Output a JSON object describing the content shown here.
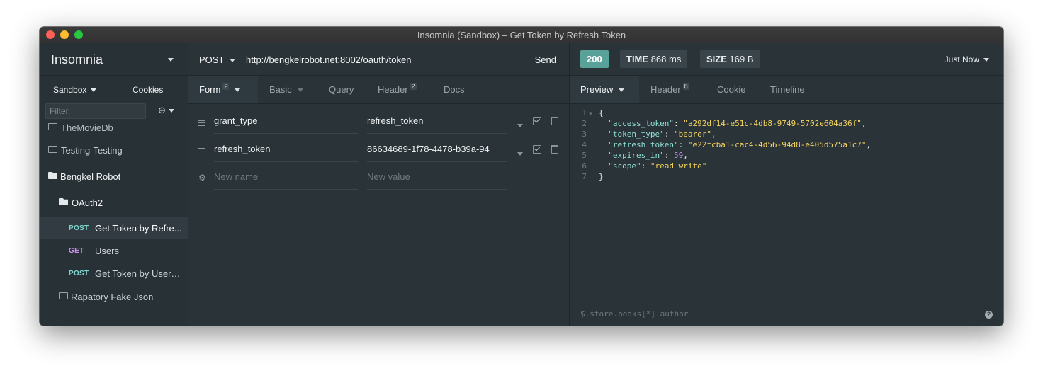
{
  "window": {
    "title": "Insomnia (Sandbox) – Get Token by Refresh Token"
  },
  "sidebar": {
    "app_name": "Insomnia",
    "environment": "Sandbox",
    "cookies_label": "Cookies",
    "filter_placeholder": "Filter",
    "add_icon": "plus-circle-icon",
    "items": [
      {
        "type": "folder",
        "label": "TheMovieDb"
      },
      {
        "type": "folder",
        "label": "Testing-Testing"
      },
      {
        "type": "folder-open",
        "label": "Bengkel Robot"
      },
      {
        "type": "folder-open",
        "label": "OAuth2"
      },
      {
        "type": "request",
        "method": "POST",
        "label": "Get Token by Refre...",
        "method_color": "#7ed6cf",
        "active": true
      },
      {
        "type": "request",
        "method": "GET",
        "label": "Users",
        "method_color": "#c792ea"
      },
      {
        "type": "request",
        "method": "POST",
        "label": "Get Token by Usern...",
        "method_color": "#7ed6cf"
      },
      {
        "type": "folder",
        "label": "Rapatory Fake Json"
      }
    ]
  },
  "request": {
    "method": "POST",
    "url": "http://bengkelrobot.net:8002/oauth/token",
    "send_label": "Send",
    "tabs": [
      {
        "label": "Form",
        "count": "2"
      },
      {
        "label": "Basic"
      },
      {
        "label": "Query"
      },
      {
        "label": "Header",
        "count": "2"
      },
      {
        "label": "Docs"
      }
    ],
    "params": [
      {
        "name": "grant_type",
        "value": "refresh_token"
      },
      {
        "name": "refresh_token",
        "value": "86634689-1f78-4478-b39a-94"
      }
    ],
    "new_name_placeholder": "New name",
    "new_value_placeholder": "New value"
  },
  "response": {
    "status": "200",
    "time_label": "TIME",
    "time_value": "868 ms",
    "size_label": "SIZE",
    "size_value": "169 B",
    "when": "Just Now",
    "tabs": [
      {
        "label": "Preview"
      },
      {
        "label": "Header",
        "count": "8"
      },
      {
        "label": "Cookie"
      },
      {
        "label": "Timeline"
      }
    ],
    "line_numbers": [
      "1",
      "2",
      "3",
      "4",
      "5",
      "6",
      "7"
    ],
    "body": {
      "access_token": "\"a292df14-e51c-4db8-9749-5702e604a36f\"",
      "token_type": "\"bearer\"",
      "refresh_token": "\"e22fcba1-cac4-4d56-94d8-e405d575a1c7\"",
      "expires_in": "59",
      "scope": "\"read write\""
    },
    "keys": {
      "access_token": "\"access_token\"",
      "token_type": "\"token_type\"",
      "refresh_token": "\"refresh_token\"",
      "expires_in": "\"expires_in\"",
      "scope": "\"scope\""
    },
    "query_placeholder": "$.store.books[*].author",
    "help_label": "?"
  }
}
